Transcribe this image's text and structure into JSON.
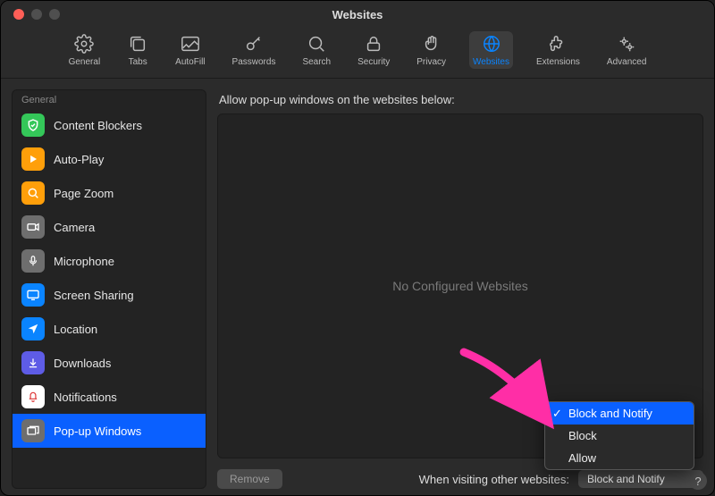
{
  "window": {
    "title": "Websites"
  },
  "toolbar": {
    "items": [
      {
        "label": "General"
      },
      {
        "label": "Tabs"
      },
      {
        "label": "AutoFill"
      },
      {
        "label": "Passwords"
      },
      {
        "label": "Search"
      },
      {
        "label": "Security"
      },
      {
        "label": "Privacy"
      },
      {
        "label": "Websites"
      },
      {
        "label": "Extensions"
      },
      {
        "label": "Advanced"
      }
    ]
  },
  "sidebar": {
    "heading": "General",
    "items": [
      {
        "label": "Content Blockers",
        "iconColor": "#34c759"
      },
      {
        "label": "Auto-Play",
        "iconColor": "#ff9f0a"
      },
      {
        "label": "Page Zoom",
        "iconColor": "#ff9f0a"
      },
      {
        "label": "Camera",
        "iconColor": "#6e6e6e"
      },
      {
        "label": "Microphone",
        "iconColor": "#6e6e6e"
      },
      {
        "label": "Screen Sharing",
        "iconColor": "#0a84ff"
      },
      {
        "label": "Location",
        "iconColor": "#0a84ff"
      },
      {
        "label": "Downloads",
        "iconColor": "#5e5ce6"
      },
      {
        "label": "Notifications",
        "iconColor": "#ffffff"
      },
      {
        "label": "Pop-up Windows",
        "iconColor": "#6e6e6e"
      }
    ]
  },
  "main": {
    "description": "Allow pop-up windows on the websites below:",
    "empty": "No Configured Websites",
    "remove": "Remove",
    "when_label": "When visiting other websites:",
    "selected": "Block and Notify"
  },
  "dropdown": {
    "options": [
      {
        "label": "Block and Notify"
      },
      {
        "label": "Block"
      },
      {
        "label": "Allow"
      }
    ]
  },
  "help": "?"
}
